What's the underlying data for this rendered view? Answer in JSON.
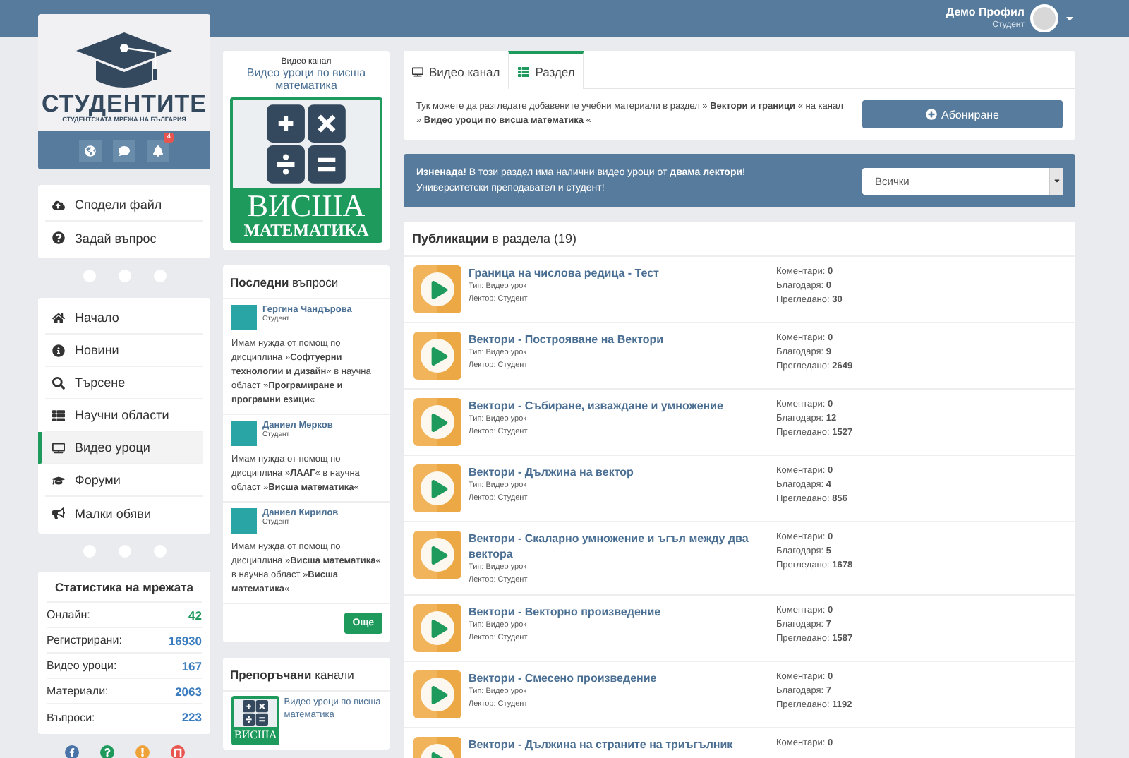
{
  "topbar": {
    "user_name": "Демо Профил",
    "user_role": "Студент"
  },
  "brand": {
    "name": "СТУДЕНТИТЕ",
    "tagline": "СТУДЕНТСКАТА МРЕЖА НА БЪЛГАРИЯ",
    "notification_count": "4"
  },
  "actions": [
    {
      "label": "Сподели файл"
    },
    {
      "label": "Задай въпрос"
    }
  ],
  "nav": [
    {
      "label": "Начало",
      "selected": false
    },
    {
      "label": "Новини",
      "selected": false
    },
    {
      "label": "Търсене",
      "selected": false
    },
    {
      "label": "Научни области",
      "selected": false
    },
    {
      "label": "Видео уроци",
      "selected": true
    },
    {
      "label": "Форуми",
      "selected": false
    },
    {
      "label": "Малки обяви",
      "selected": false
    }
  ],
  "stats": {
    "title": "Статистика на мрежата",
    "rows": [
      {
        "label": "Онлайн:",
        "value": "42",
        "color": "#1e9a5c"
      },
      {
        "label": "Регистрирани:",
        "value": "16930",
        "color": "#3b7dbf"
      },
      {
        "label": "Видео уроци:",
        "value": "167",
        "color": "#3b7dbf"
      },
      {
        "label": "Материали:",
        "value": "2063",
        "color": "#3b7dbf"
      },
      {
        "label": "Въпроси:",
        "value": "223",
        "color": "#3b7dbf"
      }
    ]
  },
  "social": [
    {
      "color": "#4a74a8"
    },
    {
      "color": "#1e9a5c"
    },
    {
      "color": "#f0a23a"
    },
    {
      "color": "#e8544e"
    }
  ],
  "channel": {
    "caption": "Видео канал",
    "name": "Видео уроци по висша математика",
    "cover_line1": "ВИСША",
    "cover_line2": "МАТЕМАТИКА"
  },
  "questions": {
    "title": "**Последни** въпроси",
    "items": [
      {
        "author": "Гергина Чандърова",
        "role": "Студент",
        "text": "Имам нужда от помощ по дисциплина »**Софтуерни технологии и дизайн**« в научна област »**Програмиране и програмни езици**«"
      },
      {
        "author": "Даниел Мерков",
        "role": "Студент",
        "text": "Имам нужда от помощ по дисциплина »**ЛААГ**« в научна област »**Висша математика**«"
      },
      {
        "author": "Даниел Кирилов",
        "role": "Студент",
        "text": "Имам нужда от помощ по дисциплина »**Висша математика**« в научна област »**Висша математика**«"
      }
    ],
    "more_button": "Още"
  },
  "recommended": {
    "title": "**Препоръчани** канали",
    "items": [
      {
        "name": "Видео уроци по висша математика",
        "cover": "ВИСША"
      }
    ]
  },
  "tabs": [
    {
      "label": "Видео канал",
      "selected": false
    },
    {
      "label": "Раздел",
      "selected": true
    }
  ],
  "intro": "Тук можете да разгледате добавените учебни материали в раздел » **Вектори и граници** « на канал » **Видео уроци по висша математика** «",
  "subscribe_button": "Абониране",
  "notice": {
    "lines": [
      "**Изненада!** В този раздел има налични видео уроци от **двама лектори**!",
      "Университетски преподавател и студент!"
    ],
    "filter_value": "Всички"
  },
  "publications": {
    "title": "**Публикации** в раздела (19)",
    "rows": [
      {
        "title": "Граница на числова редица - Тест",
        "details": [
          "Тип: Видео урок",
          "Лектор: Студент"
        ],
        "stats": [
          {
            "label": "Коментари:",
            "value": "0"
          },
          {
            "label": "Благодаря:",
            "value": "0"
          },
          {
            "label": "Прегледано:",
            "value": "30"
          }
        ]
      },
      {
        "title": "Вектори - Построяване на Вектори",
        "details": [
          "Тип: Видео урок",
          "Лектор: Студент"
        ],
        "stats": [
          {
            "label": "Коментари:",
            "value": "0"
          },
          {
            "label": "Благодаря:",
            "value": "9"
          },
          {
            "label": "Прегледано:",
            "value": "2649"
          }
        ]
      },
      {
        "title": "Вектори - Събиране, изваждане и умножение",
        "details": [
          "Тип: Видео урок",
          "Лектор: Студент"
        ],
        "stats": [
          {
            "label": "Коментари:",
            "value": "0"
          },
          {
            "label": "Благодаря:",
            "value": "12"
          },
          {
            "label": "Прегледано:",
            "value": "1527"
          }
        ]
      },
      {
        "title": "Вектори - Дължина на вектор",
        "details": [
          "Тип: Видео урок",
          "Лектор: Студент"
        ],
        "stats": [
          {
            "label": "Коментари:",
            "value": "0"
          },
          {
            "label": "Благодаря:",
            "value": "4"
          },
          {
            "label": "Прегледано:",
            "value": "856"
          }
        ]
      },
      {
        "title": "Вектори - Скаларно умножение и ъгъл между два вектора",
        "details": [
          "Тип: Видео урок",
          "Лектор: Студент"
        ],
        "stats": [
          {
            "label": "Коментари:",
            "value": "0"
          },
          {
            "label": "Благодаря:",
            "value": "5"
          },
          {
            "label": "Прегледано:",
            "value": "1678"
          }
        ]
      },
      {
        "title": "Вектори - Векторно произведение",
        "details": [
          "Тип: Видео урок",
          "Лектор: Студент"
        ],
        "stats": [
          {
            "label": "Коментари:",
            "value": "0"
          },
          {
            "label": "Благодаря:",
            "value": "7"
          },
          {
            "label": "Прегледано:",
            "value": "1587"
          }
        ]
      },
      {
        "title": "Вектори - Смесено произведение",
        "details": [
          "Тип: Видео урок",
          "Лектор: Студент"
        ],
        "stats": [
          {
            "label": "Коментари:",
            "value": "0"
          },
          {
            "label": "Благодаря:",
            "value": "7"
          },
          {
            "label": "Прегледано:",
            "value": "1192"
          }
        ]
      },
      {
        "title": "Вектори - Дължина на страните на триъгълник",
        "stats": [
          {
            "label": "Коментари:",
            "value": "0"
          }
        ]
      }
    ]
  }
}
